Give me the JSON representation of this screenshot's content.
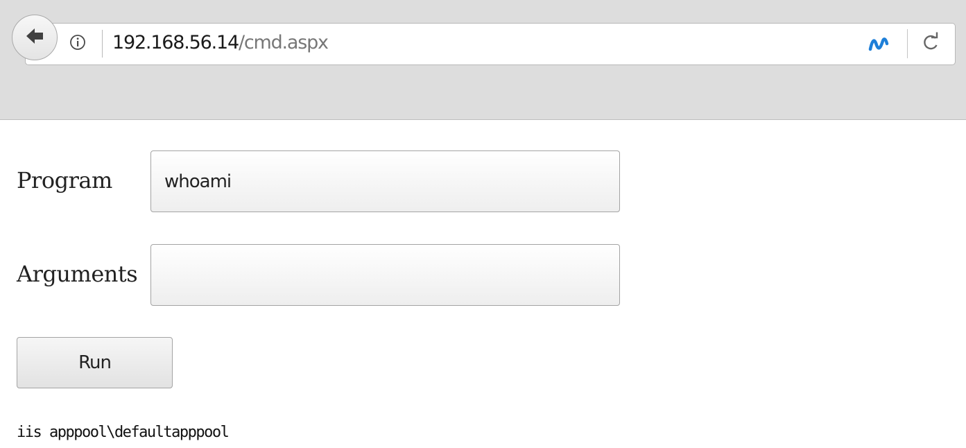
{
  "browser": {
    "url_host": "192.168.56.14",
    "url_path": "/cmd.aspx",
    "icons": {
      "back": "back-arrow-icon",
      "info": "info-icon",
      "site": "dotnet-icon",
      "reload": "reload-icon"
    },
    "colors": {
      "chrome_bg": "#dddddd",
      "site_icon": "#1e7fd8"
    }
  },
  "form": {
    "program_label": "Program",
    "program_value": "whoami",
    "arguments_label": "Arguments",
    "arguments_value": "",
    "run_label": "Run"
  },
  "output": {
    "text": "iis apppool\\defaultapppool"
  }
}
